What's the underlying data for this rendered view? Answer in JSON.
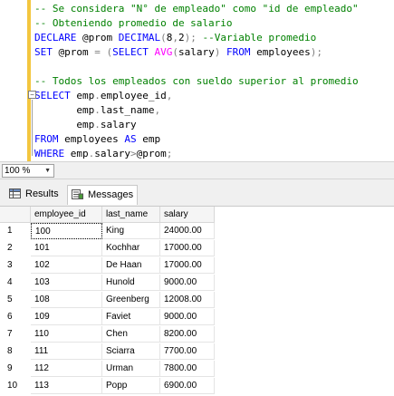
{
  "editor": {
    "lines": [
      {
        "parts": [
          {
            "t": "-- Se considera \"N° de empleado\" como \"id de empleado\"",
            "c": "comment"
          }
        ]
      },
      {
        "parts": [
          {
            "t": "-- Obteniendo promedio de salario",
            "c": "comment"
          }
        ]
      },
      {
        "parts": [
          {
            "t": "DECLARE ",
            "c": "kw"
          },
          {
            "t": "@prom ",
            "c": ""
          },
          {
            "t": "DECIMAL",
            "c": "kw"
          },
          {
            "t": "(",
            "c": "op"
          },
          {
            "t": "8",
            "c": ""
          },
          {
            "t": ",",
            "c": "op"
          },
          {
            "t": "2",
            "c": ""
          },
          {
            "t": ");",
            "c": "op"
          },
          {
            "t": " --Variable promedio",
            "c": "comment"
          }
        ]
      },
      {
        "parts": [
          {
            "t": "SET ",
            "c": "kw"
          },
          {
            "t": "@prom ",
            "c": ""
          },
          {
            "t": "= ",
            "c": "op"
          },
          {
            "t": "(",
            "c": "op"
          },
          {
            "t": "SELECT ",
            "c": "kw"
          },
          {
            "t": "AVG",
            "c": "fn"
          },
          {
            "t": "(",
            "c": "op"
          },
          {
            "t": "salary",
            "c": ""
          },
          {
            "t": ") ",
            "c": "op"
          },
          {
            "t": "FROM ",
            "c": "kw"
          },
          {
            "t": "employees",
            "c": ""
          },
          {
            "t": ");",
            "c": "op"
          }
        ]
      },
      {
        "parts": []
      },
      {
        "parts": [
          {
            "t": "-- Todos los empleados con sueldo superior al promedio",
            "c": "comment"
          }
        ]
      },
      {
        "parts": [
          {
            "t": "SELECT ",
            "c": "kw"
          },
          {
            "t": "emp",
            "c": ""
          },
          {
            "t": ".",
            "c": "op"
          },
          {
            "t": "employee_id",
            "c": ""
          },
          {
            "t": ",",
            "c": "op"
          }
        ]
      },
      {
        "parts": [
          {
            "t": "       emp",
            "c": ""
          },
          {
            "t": ".",
            "c": "op"
          },
          {
            "t": "last_name",
            "c": ""
          },
          {
            "t": ",",
            "c": "op"
          }
        ]
      },
      {
        "parts": [
          {
            "t": "       emp",
            "c": ""
          },
          {
            "t": ".",
            "c": "op"
          },
          {
            "t": "salary",
            "c": ""
          }
        ]
      },
      {
        "parts": [
          {
            "t": "FROM ",
            "c": "kw"
          },
          {
            "t": "employees ",
            "c": ""
          },
          {
            "t": "AS ",
            "c": "kw"
          },
          {
            "t": "emp",
            "c": ""
          }
        ]
      },
      {
        "parts": [
          {
            "t": "WHERE ",
            "c": "kw"
          },
          {
            "t": "emp",
            "c": ""
          },
          {
            "t": ".",
            "c": "op"
          },
          {
            "t": "salary",
            "c": ""
          },
          {
            "t": ">",
            "c": "op"
          },
          {
            "t": "@prom",
            "c": ""
          },
          {
            "t": ";",
            "c": "op"
          }
        ]
      }
    ]
  },
  "zoom": {
    "value": "100 %"
  },
  "tabs": {
    "results": "Results",
    "messages": "Messages"
  },
  "grid": {
    "columns": [
      "employee_id",
      "last_name",
      "salary"
    ],
    "rows": [
      {
        "n": "1",
        "employee_id": "100",
        "last_name": "King",
        "salary": "24000.00"
      },
      {
        "n": "2",
        "employee_id": "101",
        "last_name": "Kochhar",
        "salary": "17000.00"
      },
      {
        "n": "3",
        "employee_id": "102",
        "last_name": "De Haan",
        "salary": "17000.00"
      },
      {
        "n": "4",
        "employee_id": "103",
        "last_name": "Hunold",
        "salary": "9000.00"
      },
      {
        "n": "5",
        "employee_id": "108",
        "last_name": "Greenberg",
        "salary": "12008.00"
      },
      {
        "n": "6",
        "employee_id": "109",
        "last_name": "Faviet",
        "salary": "9000.00"
      },
      {
        "n": "7",
        "employee_id": "110",
        "last_name": "Chen",
        "salary": "8200.00"
      },
      {
        "n": "8",
        "employee_id": "111",
        "last_name": "Sciarra",
        "salary": "7700.00"
      },
      {
        "n": "9",
        "employee_id": "112",
        "last_name": "Urman",
        "salary": "7800.00"
      },
      {
        "n": "10",
        "employee_id": "113",
        "last_name": "Popp",
        "salary": "6900.00"
      }
    ]
  }
}
